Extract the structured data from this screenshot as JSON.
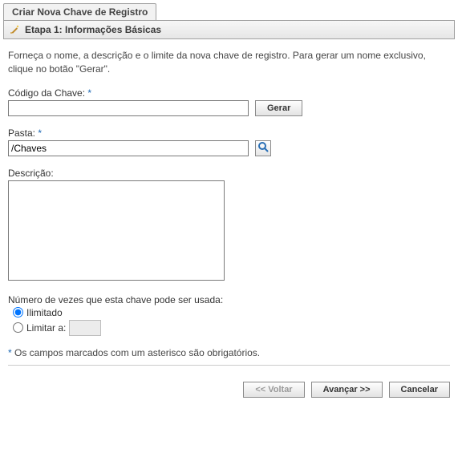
{
  "header": {
    "tab_title": "Criar Nova Chave de Registro",
    "step_title": "Etapa 1: Informações Básicas"
  },
  "intro": "Forneça o nome, a descrição e o limite da nova chave de registro. Para gerar um nome exclusivo, clique no botão \"Gerar\".",
  "fields": {
    "code": {
      "label": "Código da Chave:",
      "value": "",
      "generate_label": "Gerar"
    },
    "folder": {
      "label": "Pasta:",
      "value": "/Chaves"
    },
    "desc": {
      "label": "Descrição:",
      "value": ""
    },
    "usage": {
      "label": "Número de vezes que esta chave pode ser usada:",
      "unlimited_label": "Ilimitado",
      "limit_label": "Limitar a:",
      "limit_value": ""
    }
  },
  "footnote": {
    "marker": "*",
    "text": "Os campos marcados com um asterisco são obrigatórios."
  },
  "buttons": {
    "back": "<< Voltar",
    "next": "Avançar >>",
    "cancel": "Cancelar"
  },
  "marker": "*"
}
